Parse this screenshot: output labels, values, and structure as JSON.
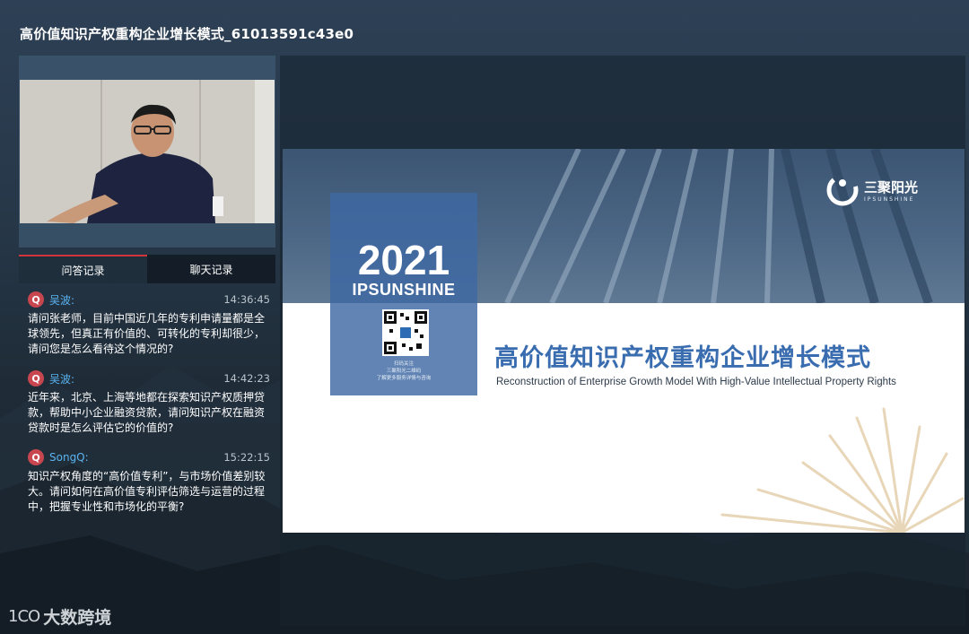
{
  "window": {
    "title": "高价值知识产权重构企业增长模式_61013591c43e0"
  },
  "tabs": [
    {
      "label": "问答记录",
      "active": true
    },
    {
      "label": "聊天记录",
      "active": false
    }
  ],
  "qa": [
    {
      "badge": "Q",
      "name": "吴波:",
      "time": "14:36:45",
      "text": "请问张老师，目前中国近几年的专利申请量都是全球领先，但真正有价值的、可转化的专利却很少，请问您是怎么看待这个情况的?"
    },
    {
      "badge": "Q",
      "name": "吴波:",
      "time": "14:42:23",
      "text": "近年来，北京、上海等地都在探索知识产权质押贷款，帮助中小企业融资贷款，请问知识产权在融资贷款时是怎么评估它的价值的?"
    },
    {
      "badge": "Q",
      "name": "SongQ:",
      "time": "15:22:15",
      "text": "知识产权角度的“高价值专利”，与市场价值差别较大。请问如何在高价值专利评估筛选与运营的过程中，把握专业性和市场化的平衡?"
    }
  ],
  "footer_logo": {
    "mark": "1CO",
    "text": "大数跨境"
  },
  "slide": {
    "year": "2021",
    "year_sub": "IPSUNSHINE",
    "qr_caption": [
      "扫码关注",
      "三聚阳光二维码",
      "了解更多服务详情与咨询"
    ],
    "brand_cn": "三聚阳光",
    "brand_en": "IPSUNSHINE",
    "main_title": "高价值知识产权重构企业增长模式",
    "sub_title": "Reconstruction of Enterprise Growth Model With High-Value Intellectual Property Rights"
  },
  "colors": {
    "accent_red": "#c8464f",
    "name_blue": "#5ab3f0",
    "slide_title_blue": "#3a6db0"
  }
}
